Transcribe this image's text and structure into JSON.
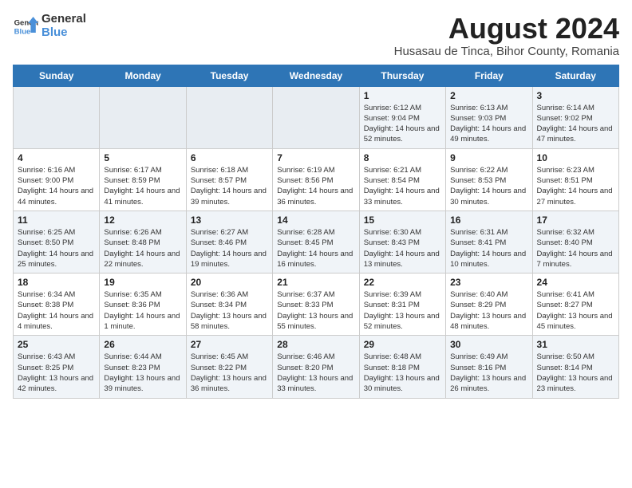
{
  "header": {
    "logo_general": "General",
    "logo_blue": "Blue",
    "month_year": "August 2024",
    "location": "Husasau de Tinca, Bihor County, Romania"
  },
  "columns": [
    "Sunday",
    "Monday",
    "Tuesday",
    "Wednesday",
    "Thursday",
    "Friday",
    "Saturday"
  ],
  "weeks": [
    [
      {
        "day": "",
        "detail": ""
      },
      {
        "day": "",
        "detail": ""
      },
      {
        "day": "",
        "detail": ""
      },
      {
        "day": "",
        "detail": ""
      },
      {
        "day": "1",
        "detail": "Sunrise: 6:12 AM\nSunset: 9:04 PM\nDaylight: 14 hours and 52 minutes."
      },
      {
        "day": "2",
        "detail": "Sunrise: 6:13 AM\nSunset: 9:03 PM\nDaylight: 14 hours and 49 minutes."
      },
      {
        "day": "3",
        "detail": "Sunrise: 6:14 AM\nSunset: 9:02 PM\nDaylight: 14 hours and 47 minutes."
      }
    ],
    [
      {
        "day": "4",
        "detail": "Sunrise: 6:16 AM\nSunset: 9:00 PM\nDaylight: 14 hours and 44 minutes."
      },
      {
        "day": "5",
        "detail": "Sunrise: 6:17 AM\nSunset: 8:59 PM\nDaylight: 14 hours and 41 minutes."
      },
      {
        "day": "6",
        "detail": "Sunrise: 6:18 AM\nSunset: 8:57 PM\nDaylight: 14 hours and 39 minutes."
      },
      {
        "day": "7",
        "detail": "Sunrise: 6:19 AM\nSunset: 8:56 PM\nDaylight: 14 hours and 36 minutes."
      },
      {
        "day": "8",
        "detail": "Sunrise: 6:21 AM\nSunset: 8:54 PM\nDaylight: 14 hours and 33 minutes."
      },
      {
        "day": "9",
        "detail": "Sunrise: 6:22 AM\nSunset: 8:53 PM\nDaylight: 14 hours and 30 minutes."
      },
      {
        "day": "10",
        "detail": "Sunrise: 6:23 AM\nSunset: 8:51 PM\nDaylight: 14 hours and 27 minutes."
      }
    ],
    [
      {
        "day": "11",
        "detail": "Sunrise: 6:25 AM\nSunset: 8:50 PM\nDaylight: 14 hours and 25 minutes."
      },
      {
        "day": "12",
        "detail": "Sunrise: 6:26 AM\nSunset: 8:48 PM\nDaylight: 14 hours and 22 minutes."
      },
      {
        "day": "13",
        "detail": "Sunrise: 6:27 AM\nSunset: 8:46 PM\nDaylight: 14 hours and 19 minutes."
      },
      {
        "day": "14",
        "detail": "Sunrise: 6:28 AM\nSunset: 8:45 PM\nDaylight: 14 hours and 16 minutes."
      },
      {
        "day": "15",
        "detail": "Sunrise: 6:30 AM\nSunset: 8:43 PM\nDaylight: 14 hours and 13 minutes."
      },
      {
        "day": "16",
        "detail": "Sunrise: 6:31 AM\nSunset: 8:41 PM\nDaylight: 14 hours and 10 minutes."
      },
      {
        "day": "17",
        "detail": "Sunrise: 6:32 AM\nSunset: 8:40 PM\nDaylight: 14 hours and 7 minutes."
      }
    ],
    [
      {
        "day": "18",
        "detail": "Sunrise: 6:34 AM\nSunset: 8:38 PM\nDaylight: 14 hours and 4 minutes."
      },
      {
        "day": "19",
        "detail": "Sunrise: 6:35 AM\nSunset: 8:36 PM\nDaylight: 14 hours and 1 minute."
      },
      {
        "day": "20",
        "detail": "Sunrise: 6:36 AM\nSunset: 8:34 PM\nDaylight: 13 hours and 58 minutes."
      },
      {
        "day": "21",
        "detail": "Sunrise: 6:37 AM\nSunset: 8:33 PM\nDaylight: 13 hours and 55 minutes."
      },
      {
        "day": "22",
        "detail": "Sunrise: 6:39 AM\nSunset: 8:31 PM\nDaylight: 13 hours and 52 minutes."
      },
      {
        "day": "23",
        "detail": "Sunrise: 6:40 AM\nSunset: 8:29 PM\nDaylight: 13 hours and 48 minutes."
      },
      {
        "day": "24",
        "detail": "Sunrise: 6:41 AM\nSunset: 8:27 PM\nDaylight: 13 hours and 45 minutes."
      }
    ],
    [
      {
        "day": "25",
        "detail": "Sunrise: 6:43 AM\nSunset: 8:25 PM\nDaylight: 13 hours and 42 minutes."
      },
      {
        "day": "26",
        "detail": "Sunrise: 6:44 AM\nSunset: 8:23 PM\nDaylight: 13 hours and 39 minutes."
      },
      {
        "day": "27",
        "detail": "Sunrise: 6:45 AM\nSunset: 8:22 PM\nDaylight: 13 hours and 36 minutes."
      },
      {
        "day": "28",
        "detail": "Sunrise: 6:46 AM\nSunset: 8:20 PM\nDaylight: 13 hours and 33 minutes."
      },
      {
        "day": "29",
        "detail": "Sunrise: 6:48 AM\nSunset: 8:18 PM\nDaylight: 13 hours and 30 minutes."
      },
      {
        "day": "30",
        "detail": "Sunrise: 6:49 AM\nSunset: 8:16 PM\nDaylight: 13 hours and 26 minutes."
      },
      {
        "day": "31",
        "detail": "Sunrise: 6:50 AM\nSunset: 8:14 PM\nDaylight: 13 hours and 23 minutes."
      }
    ]
  ]
}
